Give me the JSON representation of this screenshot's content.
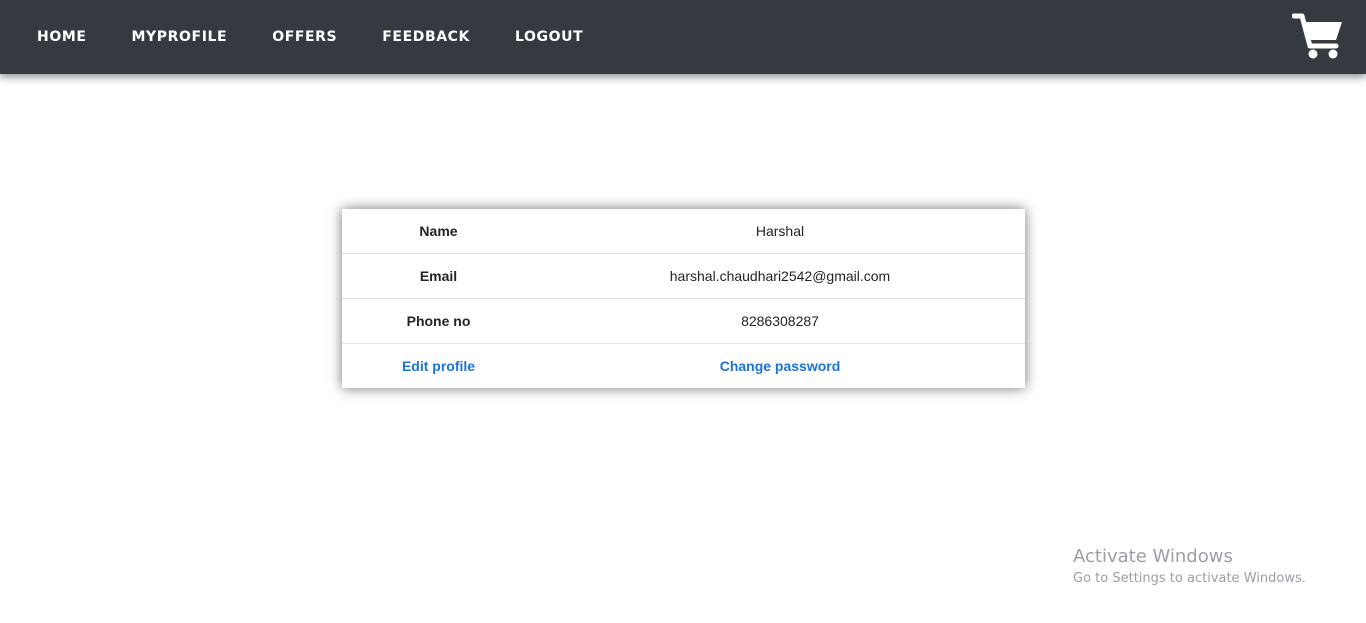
{
  "nav": {
    "items": [
      {
        "label": "HOME"
      },
      {
        "label": "MYPROFILE"
      },
      {
        "label": "OFFERS"
      },
      {
        "label": "FEEDBACK"
      },
      {
        "label": "LOGOUT"
      }
    ],
    "cart_icon": "shopping-cart-icon"
  },
  "profile": {
    "rows": [
      {
        "label": "Name",
        "value": "Harshal"
      },
      {
        "label": "Email",
        "value": "harshal.chaudhari2542@gmail.com"
      },
      {
        "label": "Phone no",
        "value": "8286308287"
      }
    ],
    "edit_profile_label": "Edit profile",
    "change_password_label": "Change password"
  },
  "watermark": {
    "title": "Activate Windows",
    "subtitle": "Go to Settings to activate Windows."
  },
  "colors": {
    "navbar": "#343a40",
    "link": "#1a73d9"
  }
}
